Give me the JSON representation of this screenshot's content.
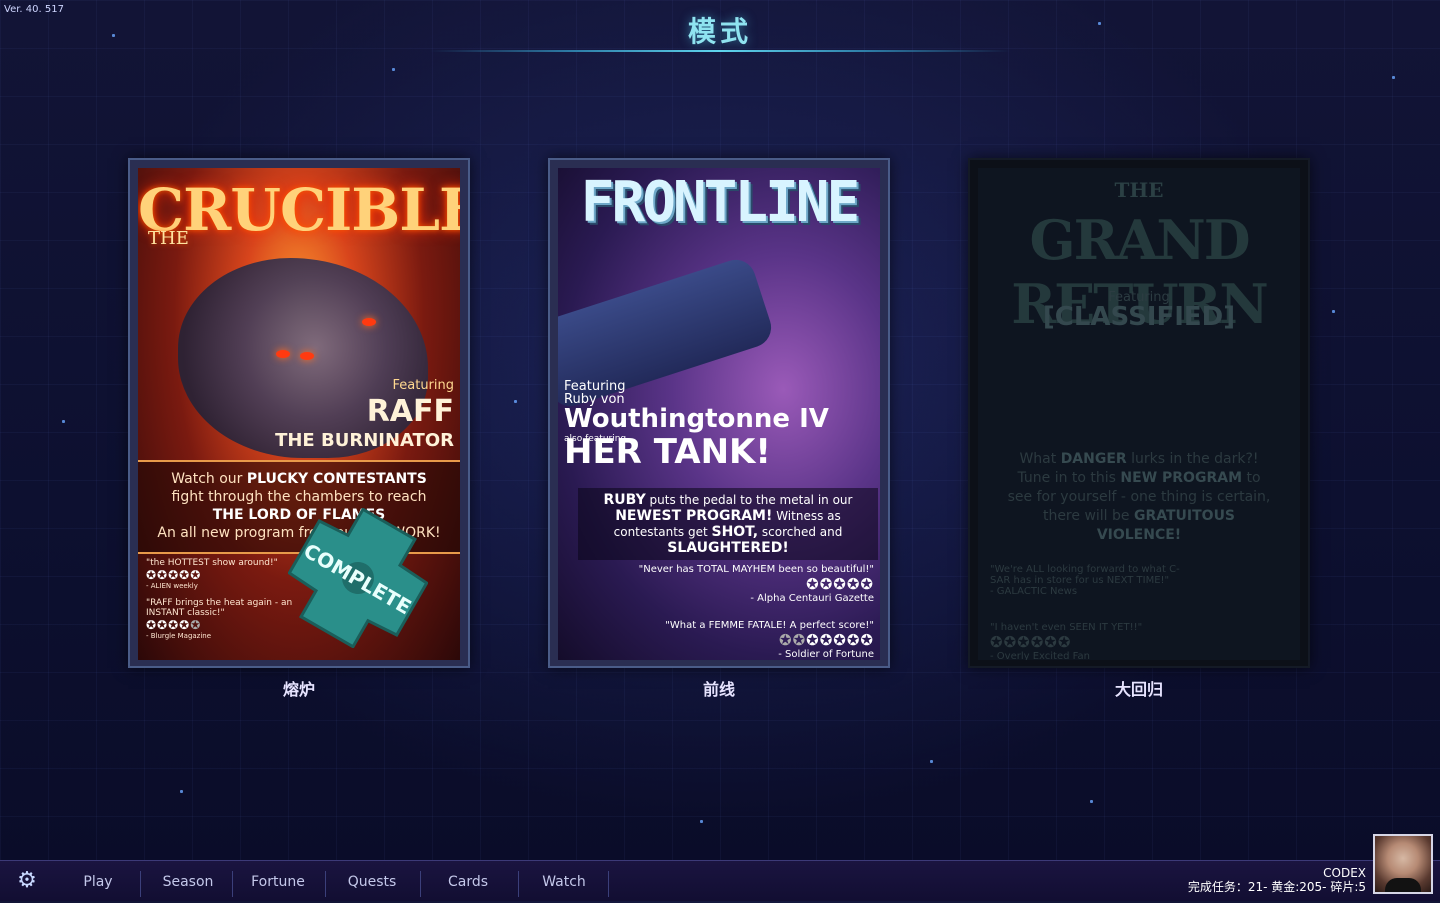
{
  "version": "Ver. 40. 517",
  "title": "模式",
  "modes": [
    {
      "caption": "熔炉",
      "poster": {
        "logo": "CRUCIBLE",
        "logo_prefix": "THE",
        "featuring": "Featuring",
        "name": "RAFF",
        "subtitle": "THE BURNINATOR",
        "blurb_1a": "Watch our ",
        "blurb_1b": "PLUCKY CONTESTANTS",
        "blurb_2": "fight through the chambers to reach",
        "blurb_3": "THE LORD OF FLAMES",
        "blurb_4": "An all new program from our NETWORK!",
        "review_1_text": "\"the HOTTEST show around!\"",
        "review_1_stars": "✪✪✪✪✪",
        "review_1_source": "- ALIEN weekly",
        "review_2_text": "\"RAFF brings the heat again - an INSTANT classic!\"",
        "review_2_stars": "✪✪✪✪",
        "review_2_stars_dim": "✪",
        "review_2_source": "- Blurgle Magazine",
        "stamp": "COMPLETE"
      }
    },
    {
      "caption": "前线",
      "poster": {
        "logo": "FRONTLINE",
        "featuring": "Featuring",
        "name_prefix": "Ruby von",
        "name": "Wouthingtonne IV",
        "also": "also featuring",
        "tank": "HER TANK!",
        "blurb_1a": "RUBY",
        "blurb_1b": " puts the pedal to the metal in our",
        "blurb_2a": "NEWEST PROGRAM!",
        "blurb_2b": " Witness as",
        "blurb_3a": "contestants get ",
        "blurb_3b": "SHOT,",
        "blurb_3c": " scorched and",
        "blurb_4": "SLAUGHTERED!",
        "review_1_text": "\"Never has TOTAL MAYHEM been so beautiful!\"",
        "review_1_stars": "✪✪✪✪✪",
        "review_1_source": "- Alpha Centauri Gazette",
        "review_2_text": "\"What a FEMME FATALE! A perfect score!\"",
        "review_2_stars": "✪✪✪✪✪",
        "review_2_stars_dim": "✪✪",
        "review_2_source": "- Soldier of Fortune"
      }
    },
    {
      "caption": "大回归",
      "poster": {
        "logo_prefix": "THE",
        "logo": "GRAND RETURN",
        "featuring": "Featuring",
        "name": "[CLASSIFIED]",
        "blurb_1a": "What ",
        "blurb_1b": "DANGER",
        "blurb_1c": " lurks in the dark?!",
        "blurb_2a": "Tune in to this ",
        "blurb_2b": "NEW PROGRAM",
        "blurb_2c": " to",
        "blurb_3": "see for yourself - one thing is certain,",
        "blurb_4a": "there will be ",
        "blurb_4b": "GRATUITOUS",
        "blurb_5": "VIOLENCE!",
        "review_1_text": "\"We're ALL looking forward to what C-SAR has in store for us NEXT TIME!\"",
        "review_1_source": "- GALACTIC News",
        "review_2_text": "\"I haven't even SEEN IT YET!!\"",
        "review_2_stars": "✪✪✪✪✪✪",
        "review_2_source": "- Overly Excited Fan"
      }
    }
  ],
  "nav": [
    "Play",
    "Season",
    "Fortune",
    "Quests",
    "Cards",
    "Watch"
  ],
  "player": {
    "name": "CODEX",
    "stats": "完成任务：21-  黄金:205-  碎片:5"
  },
  "icons": {
    "settings": "gear-icon",
    "avatar": "avatar"
  },
  "colors": {
    "title": "#8fe3f0",
    "bar": "#1a1440",
    "stamp": "#2a8f8a"
  }
}
